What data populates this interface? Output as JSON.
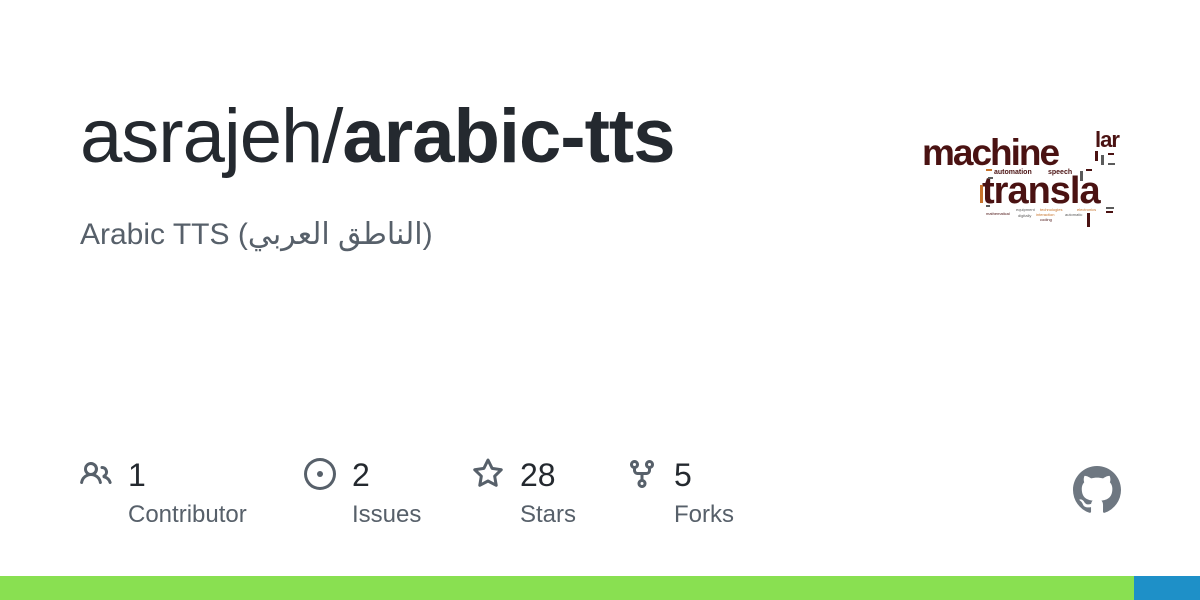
{
  "repo": {
    "owner": "asrajeh/",
    "name": "arabic-tts",
    "description": "Arabic TTS (الناطق العربي)"
  },
  "logo": {
    "words": {
      "machine": "machine",
      "transla": "transla",
      "lar": "lar",
      "automation": "automation",
      "speech": "speech",
      "equipment": "equipment",
      "technologies": "technologies",
      "electronics": "electronics",
      "mathematical": "mathematical",
      "digitally": "digitally",
      "interaction": "interaction",
      "automatic": "automatic",
      "coding": "coding"
    },
    "colors": {
      "dark": "#4a1212",
      "accent": "#c8742c",
      "muted": "#5b5b5b"
    }
  },
  "stats": [
    {
      "icon": "people-icon",
      "value": "1",
      "label": "Contributor"
    },
    {
      "icon": "issue-opened-icon",
      "value": "2",
      "label": "Issues"
    },
    {
      "icon": "star-icon",
      "value": "28",
      "label": "Stars"
    },
    {
      "icon": "repo-forked-icon",
      "value": "5",
      "label": "Forks"
    }
  ],
  "github_mark": {
    "icon": "github-mark-icon",
    "color": "#6e7781"
  },
  "languages": [
    {
      "color": "#89e051",
      "share": 0.945
    },
    {
      "color": "#1e90c8",
      "share": 0.055
    }
  ]
}
